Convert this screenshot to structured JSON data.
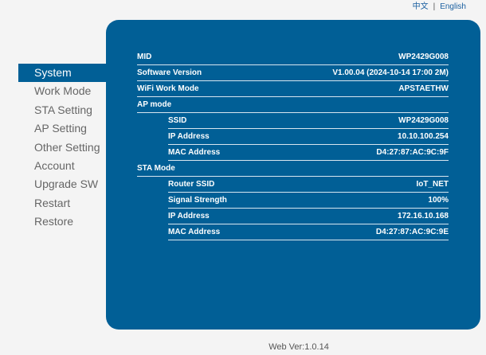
{
  "lang": {
    "zh": "中文",
    "sep": "|",
    "en": "English"
  },
  "menu": [
    "System",
    "Work Mode",
    "STA Setting",
    "AP Setting",
    "Other Setting",
    "Account",
    "Upgrade SW",
    "Restart",
    "Restore"
  ],
  "rows": [
    {
      "label": "MID",
      "value": "WP2429G008",
      "indent": false
    },
    {
      "label": "Software Version",
      "value": "V1.00.04 (2024-10-14 17:00 2M)",
      "indent": false
    },
    {
      "label": "WiFi Work Mode",
      "value": "APSTAETHW",
      "indent": false
    },
    {
      "label": "AP mode",
      "value": "",
      "indent": false
    },
    {
      "label": "SSID",
      "value": "WP2429G008",
      "indent": true
    },
    {
      "label": "IP Address",
      "value": "10.10.100.254",
      "indent": true
    },
    {
      "label": "MAC Address",
      "value": "D4:27:87:AC:9C:9F",
      "indent": true
    },
    {
      "label": "STA Mode",
      "value": "",
      "indent": false
    },
    {
      "label": "Router SSID",
      "value": "IoT_NET",
      "indent": true
    },
    {
      "label": "Signal Strength",
      "value": "100%",
      "indent": true
    },
    {
      "label": "IP Address",
      "value": "172.16.10.168",
      "indent": true
    },
    {
      "label": "MAC Address",
      "value": "D4:27:87:AC:9C:9E",
      "indent": true
    }
  ],
  "footer": "Web Ver:1.0.14"
}
